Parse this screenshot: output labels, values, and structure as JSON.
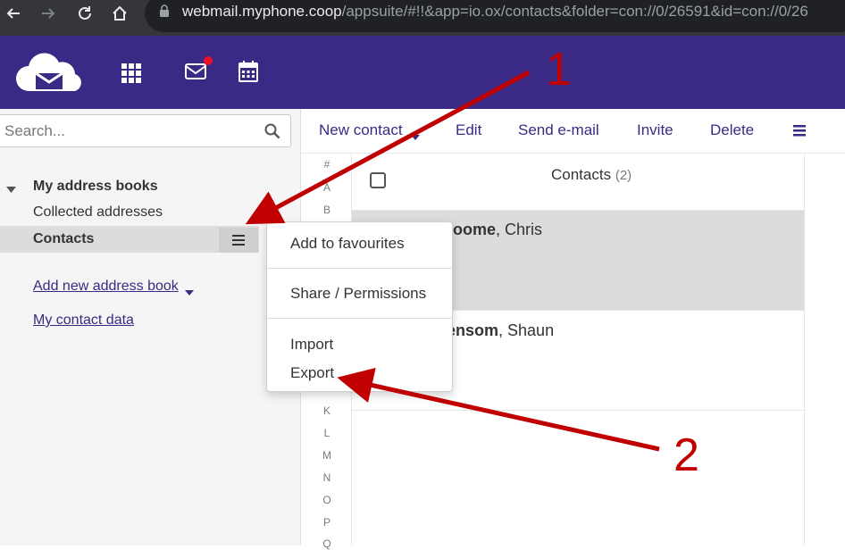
{
  "browser": {
    "url_host": "webmail.myphone.coop",
    "url_path": "/appsuite/#!!&app=io.ox/contacts&folder=con://0/26591&id=con://0/26"
  },
  "header": {
    "icons": [
      "cloud-mail-logo",
      "apps-grid-icon",
      "mail-icon",
      "calendar-icon"
    ],
    "mail_notification_color": "#e8102a",
    "bg_color": "#3a2a85"
  },
  "sidebar": {
    "search_placeholder": "Search...",
    "tree_title": "My address books",
    "items": [
      "Collected addresses",
      "Contacts"
    ],
    "add_book": "Add new address book",
    "my_contact_data": "My contact data"
  },
  "toolbar": {
    "new_contact": "New contact",
    "edit": "Edit",
    "send_email": "Send e-mail",
    "invite": "Invite",
    "delete": "Delete"
  },
  "index_letters": [
    "#",
    "A",
    "B",
    "K",
    "L",
    "M",
    "N",
    "O",
    "P",
    "Q"
  ],
  "list": {
    "title": "Contacts",
    "count": "(2)",
    "contacts": [
      {
        "last": "roome",
        "first": ", Chris",
        "selected": true
      },
      {
        "last": "ensom",
        "first": ", Shaun",
        "selected": false
      }
    ]
  },
  "context_menu": {
    "items": [
      "Add to favourites",
      "Share / Permissions",
      "Import",
      "Export"
    ]
  },
  "annotations": {
    "label_1": "1",
    "label_2": "2",
    "color": "#c00000"
  }
}
